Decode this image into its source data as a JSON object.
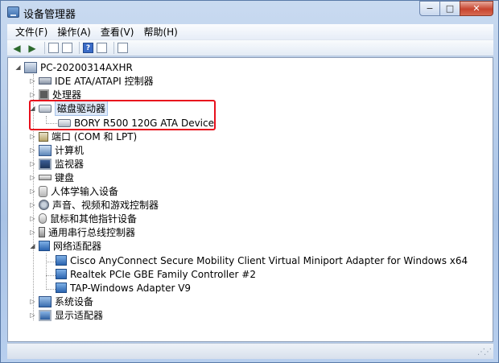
{
  "window": {
    "title": "设备管理器",
    "minimize_label": "−",
    "maximize_label": "□",
    "close_label": "✕"
  },
  "menu": [
    {
      "label": "文件(F)"
    },
    {
      "label": "操作(A)"
    },
    {
      "label": "查看(V)"
    },
    {
      "label": "帮助(H)"
    }
  ],
  "toolbar": {
    "back_icon": "◀",
    "forward_icon": "▶",
    "help_glyph": "?"
  },
  "tree": {
    "root": {
      "label": "PC-20200314AXHR",
      "icon": "computer-root-icon"
    },
    "items": [
      {
        "label": "IDE ATA/ATAPI 控制器",
        "icon": "ide-controller-icon",
        "expander": "▷"
      },
      {
        "label": "处理器",
        "icon": "processor-icon",
        "expander": "▷"
      },
      {
        "label": "磁盘驱动器",
        "icon": "disk-drive-icon",
        "expander": "◢"
      },
      {
        "label": "BORY R500 120G ATA Device",
        "icon": "disk-drive-icon"
      },
      {
        "label": "端口 (COM 和 LPT)",
        "icon": "port-icon",
        "expander": "▷"
      },
      {
        "label": "计算机",
        "icon": "computer-icon",
        "expander": "▷"
      },
      {
        "label": "监视器",
        "icon": "monitor-icon",
        "expander": "▷"
      },
      {
        "label": "键盘",
        "icon": "keyboard-icon",
        "expander": "▷"
      },
      {
        "label": "人体学输入设备",
        "icon": "hid-icon",
        "expander": "▷"
      },
      {
        "label": "声音、视频和游戏控制器",
        "icon": "sound-icon",
        "expander": "▷"
      },
      {
        "label": "鼠标和其他指针设备",
        "icon": "mouse-icon",
        "expander": "▷"
      },
      {
        "label": "通用串行总线控制器",
        "icon": "usb-icon",
        "expander": "▷"
      },
      {
        "label": "网络适配器",
        "icon": "network-adapter-icon",
        "expander": "◢"
      },
      {
        "label": "Cisco AnyConnect Secure Mobility Client Virtual Miniport Adapter for Windows x64",
        "icon": "network-adapter-icon"
      },
      {
        "label": "Realtek PCIe GBE Family Controller #2",
        "icon": "network-adapter-icon"
      },
      {
        "label": "TAP-Windows Adapter V9",
        "icon": "network-adapter-icon"
      },
      {
        "label": "系统设备",
        "icon": "system-device-icon",
        "expander": "▷"
      },
      {
        "label": "显示适配器",
        "icon": "display-adapter-icon",
        "expander": "▷"
      }
    ]
  },
  "colors": {
    "highlight_border": "#e8101c",
    "titlebar": "#b8cfee"
  }
}
